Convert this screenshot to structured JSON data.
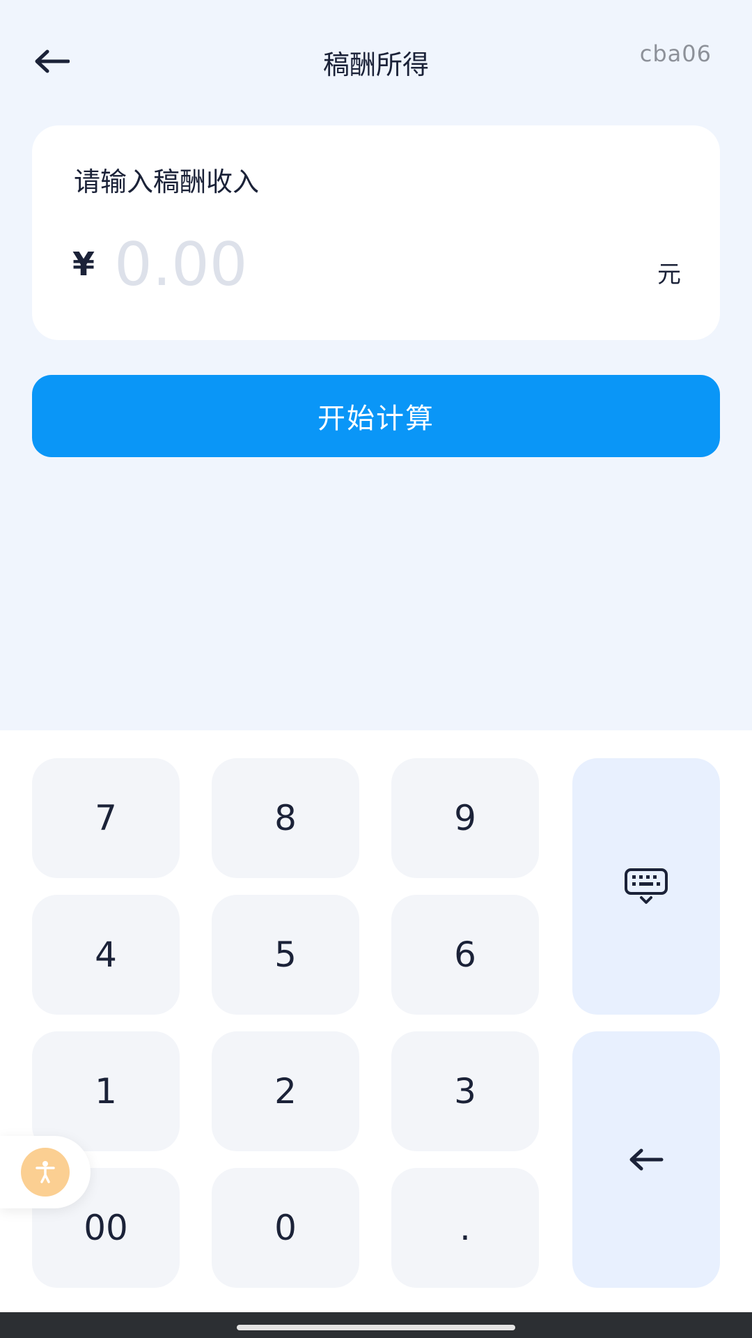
{
  "header": {
    "title": "稿酬所得",
    "watermark": "cba06"
  },
  "input_card": {
    "label": "请输入稿酬收入",
    "currency_symbol": "¥",
    "amount_placeholder": "0.00",
    "amount_value": "",
    "unit": "元"
  },
  "calc_button": {
    "label": "开始计算"
  },
  "keypad": {
    "keys": [
      "7",
      "8",
      "9",
      "4",
      "5",
      "6",
      "1",
      "2",
      "3",
      "00",
      "0",
      "."
    ]
  },
  "colors": {
    "page_background": "#f0f5fd",
    "primary_button": "#0a96f7",
    "key_background": "#f3f5f9",
    "side_key_background": "#e8f0fe",
    "placeholder_text": "#dde1ea",
    "a11y_bubble": "#fbcf92"
  },
  "icons": {
    "back": "arrow-left-icon",
    "hide_keyboard": "keyboard-hide-icon",
    "delete": "backspace-arrow-icon",
    "accessibility": "accessibility-person-icon"
  }
}
